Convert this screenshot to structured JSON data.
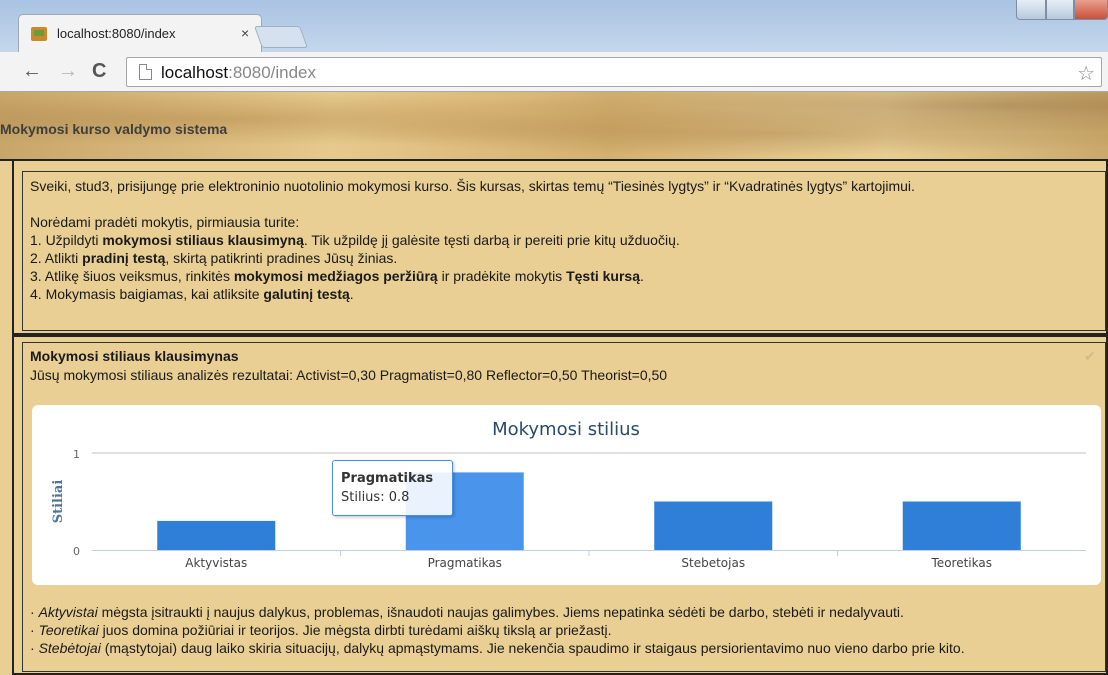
{
  "browser": {
    "tab_title": "localhost:8080/index",
    "tab_close": "×",
    "url_host": "localhost",
    "url_rest": ":8080/index",
    "back": "←",
    "forward": "→",
    "reload": "C",
    "star": "☆"
  },
  "header": {
    "title": "Mokymosi kurso valdymo sistema"
  },
  "intro": {
    "welcome": "Sveiki, stud3, prisijungę prie elektroninio nuotolinio mokymosi kurso. Šis kursas, skirtas temų “Tiesinės lygtys” ir “Kvadratinės lygtys” kartojimui.",
    "lead": "Norėdami pradėti mokytis, pirmiausia turite:",
    "steps": [
      {
        "pre": "1. Užpildyti ",
        "bold": "mokymosi stiliaus klausimyną",
        "post": ". Tik užpildę jį galėsite tęsti darbą ir pereiti prie kitų užduočių."
      },
      {
        "pre": "2. Atlikti ",
        "bold": "pradinį testą",
        "post": ", skirtą patikrinti pradines Jūsų žinias."
      },
      {
        "pre": "3. Atlikę šiuos veiksmus, rinkitės ",
        "bold": "mokymosi medžiagos peržiūrą",
        "post": " ir pradėkite mokytis ",
        "bold2": "Tęsti kursą",
        "post2": "."
      },
      {
        "pre": "4. Mokymasis baigiamas, kai atliksite ",
        "bold": "galutinį testą",
        "post": "."
      }
    ]
  },
  "questionnaire": {
    "title": "Mokymosi stiliaus klausimynas",
    "results": "Jūsų mokymosi stiliaus analizės rezultatai: Activist=0,30 Pragmatist=0,80 Reflector=0,50 Theorist=0,50",
    "check_icon": "✔"
  },
  "tooltip": {
    "title": "Pragmatikas",
    "value": "Stilius: 0.8"
  },
  "chart_data": {
    "type": "bar",
    "title": "Mokymosi stilius",
    "ylabel": "Stiliai",
    "xlabel": "",
    "categories": [
      "Aktyvistas",
      "Pragmatikas",
      "Stebetojas",
      "Teoretikas"
    ],
    "values": [
      0.3,
      0.8,
      0.5,
      0.5
    ],
    "ylim": [
      0,
      1
    ],
    "yticks": [
      "0",
      "1"
    ],
    "highlighted": "Pragmatikas",
    "bar_color": "#2f7ed8",
    "highlight_color": "#4a94ec",
    "grid": true,
    "legend": "none"
  },
  "descriptions": [
    {
      "bullet": "· ",
      "term": "Aktyvistai",
      "text": " mėgsta įsitraukti į naujus dalykus, problemas, išnaudoti naujas galimybes. Jiems nepatinka sėdėti be darbo, stebėti ir nedalyvauti."
    },
    {
      "bullet": "· ",
      "term": "Teoretikai",
      "text": " juos domina požiūriai ir teorijos. Jie mėgsta dirbti turėdami aiškų tikslą ar priežastį."
    },
    {
      "bullet": "· ",
      "term": "Stebėtojai",
      "text": " (mąstytojai) daug laiko skiria situacijų, dalykų apmąstymams. Jie nekenčia spaudimo ir staigaus persiorientavimo nuo vieno darbo prie kito."
    }
  ]
}
